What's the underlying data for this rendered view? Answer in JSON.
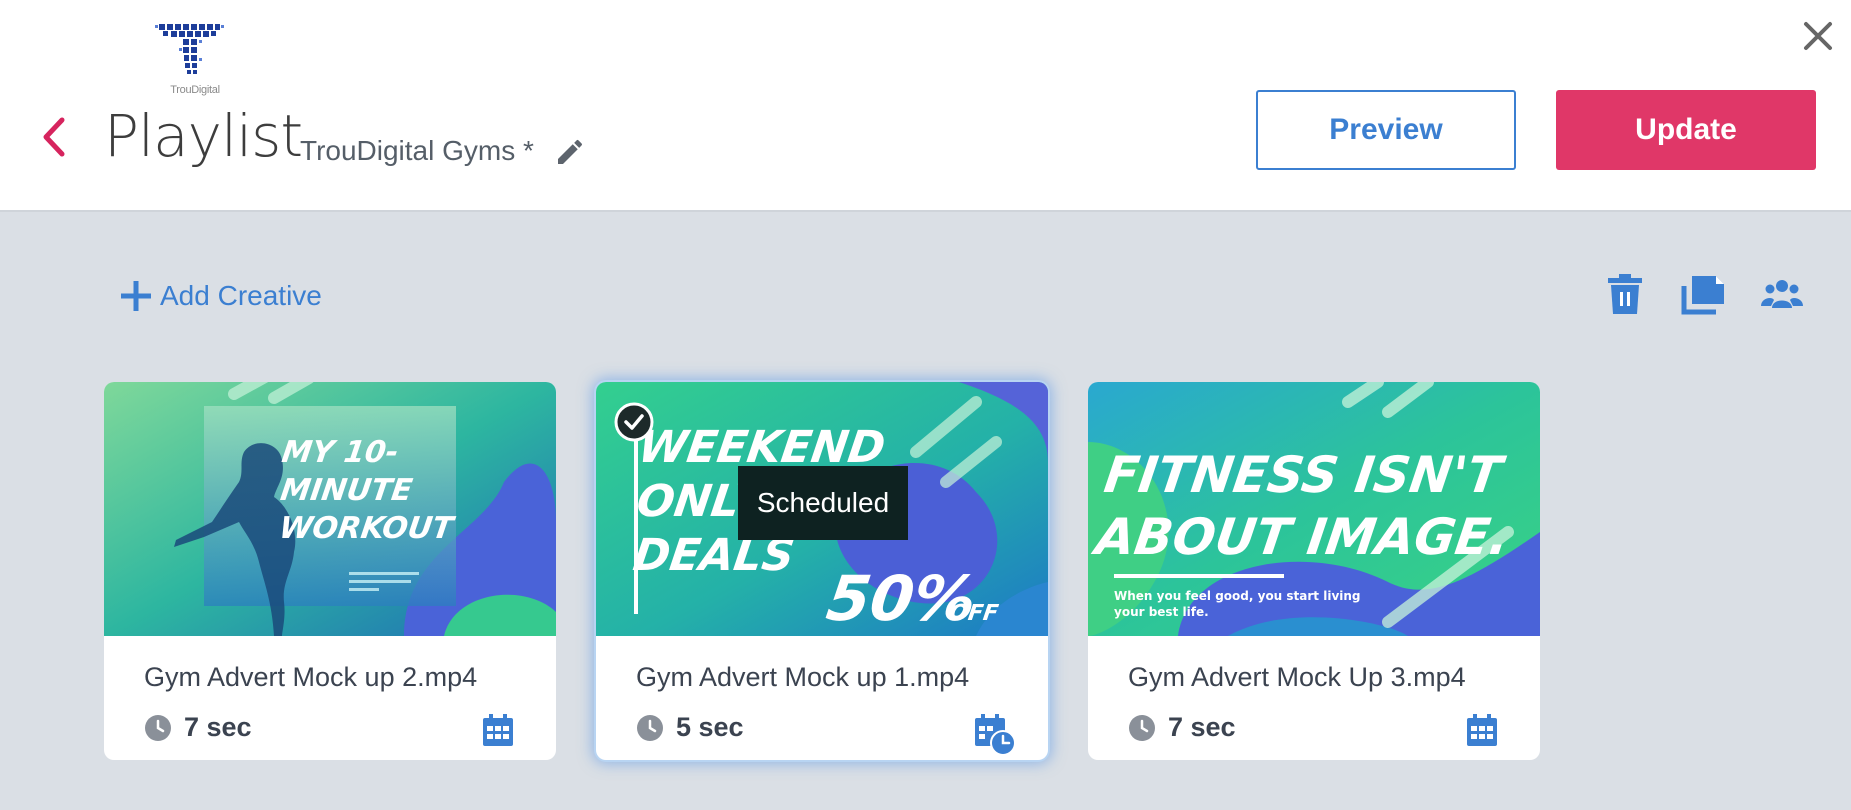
{
  "header": {
    "logo_text": "TrouDigital",
    "title": "Playlist",
    "playlist_name": "TrouDigital Gyms *",
    "preview_label": "Preview",
    "update_label": "Update"
  },
  "toolbar": {
    "add_creative_label": "Add Creative",
    "icons": [
      "trash-icon",
      "copy-icon",
      "group-icon"
    ]
  },
  "creatives": [
    {
      "name": "Gym Advert Mock up 2.mp4",
      "duration": "7 sec",
      "selected": false,
      "scheduled": false,
      "thumb_lines": [
        "MY 10-",
        "MINUTE",
        "WORKOUT"
      ]
    },
    {
      "name": "Gym Advert Mock up 1.mp4",
      "duration": "5 sec",
      "selected": true,
      "scheduled": true,
      "tooltip": "Scheduled",
      "thumb_lines": [
        "WEEKEND",
        "ONLY",
        "DEALS",
        "50%",
        "OFF"
      ]
    },
    {
      "name": "Gym Advert Mock Up 3.mp4",
      "duration": "7 sec",
      "selected": false,
      "scheduled": false,
      "thumb_lines": [
        "FITNESS ISN'T",
        "ABOUT IMAGE.",
        "When you feel good, you start living",
        "your best life."
      ]
    }
  ],
  "colors": {
    "accent_blue": "#3b7fd1",
    "update_pink": "#e03768",
    "back_arrow": "#d6245e",
    "page_bg": "#dadfe5"
  }
}
